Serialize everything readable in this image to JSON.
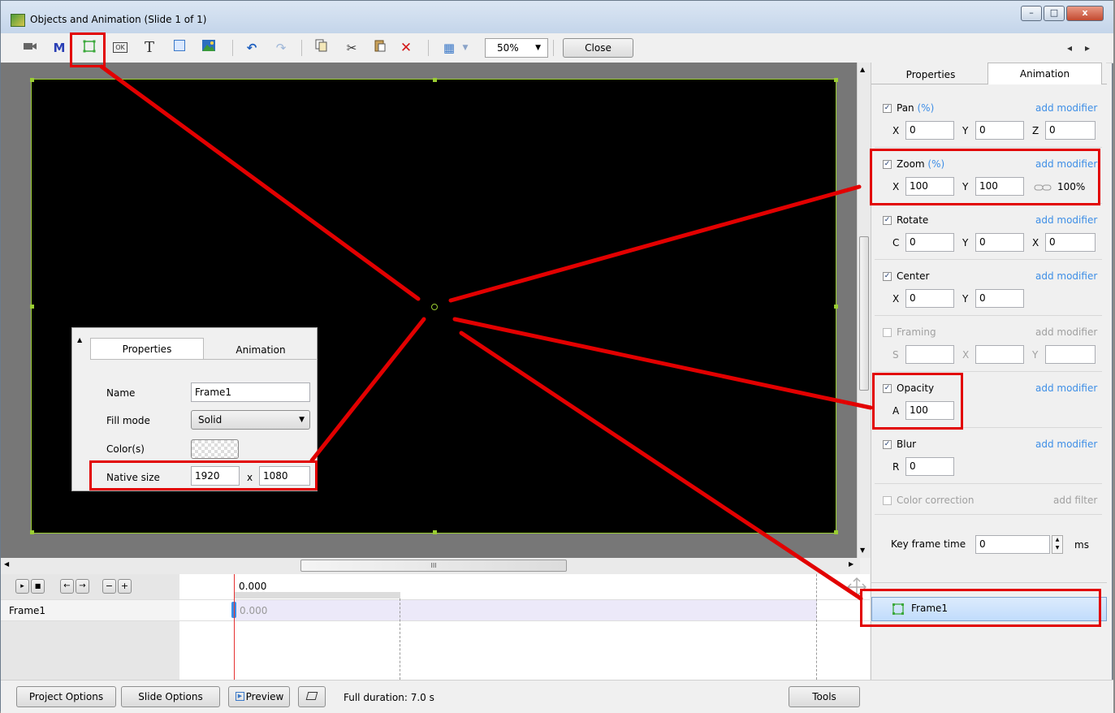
{
  "window": {
    "title": "Objects and Animation (Slide 1 of 1)",
    "minimize_glyph": "–",
    "maximize_glyph": "□",
    "close_glyph": "x"
  },
  "toolbar": {
    "icons": {
      "camera": "camera-icon",
      "mask": "M",
      "frame": "frame-icon",
      "button": "OK",
      "text": "T",
      "rectangle": "rectangle-icon",
      "image": "image-icon",
      "undo": "↶",
      "redo": "↷",
      "copy": "copy-icon",
      "cut": "✂",
      "paste": "paste-icon",
      "delete": "✕",
      "grid": "▦"
    },
    "zoom": "50%",
    "close_label": "Close",
    "nav_prev": "◂",
    "nav_next": "▸"
  },
  "properties_inset": {
    "tabs": [
      "Properties",
      "Animation"
    ],
    "name_label": "Name",
    "name_value": "Frame1",
    "fill_mode_label": "Fill mode",
    "fill_mode_value": "Solid",
    "colors_label": "Color(s)",
    "native_size_label": "Native size",
    "native_w": "1920",
    "native_x": "x",
    "native_h": "1080"
  },
  "right_panel": {
    "tabs": [
      "Properties",
      "Animation"
    ],
    "add_modifier": "add modifier",
    "add_filter": "add filter",
    "pan": {
      "label": "Pan",
      "unit": "(%)",
      "x_label": "X",
      "x": "0",
      "y_label": "Y",
      "y": "0",
      "z_label": "Z",
      "z": "0"
    },
    "zoom": {
      "label": "Zoom",
      "unit": "(%)",
      "x_label": "X",
      "x": "100",
      "y_label": "Y",
      "y": "100",
      "ratio": "100%"
    },
    "rotate": {
      "label": "Rotate",
      "c_label": "C",
      "c": "0",
      "y_label": "Y",
      "y": "0",
      "x_label": "X",
      "x": "0"
    },
    "center": {
      "label": "Center",
      "x_label": "X",
      "x": "0",
      "y_label": "Y",
      "y": "0"
    },
    "framing": {
      "label": "Framing",
      "s_label": "S",
      "x_label": "X",
      "y_label": "Y"
    },
    "opacity": {
      "label": "Opacity",
      "a_label": "A",
      "a": "100"
    },
    "blur": {
      "label": "Blur",
      "r_label": "R",
      "r": "0"
    },
    "color_correction": {
      "label": "Color correction"
    },
    "key_frame": {
      "label": "Key frame time",
      "value": "0",
      "unit": "ms"
    },
    "objects": [
      {
        "name": "Frame1"
      }
    ]
  },
  "timeline": {
    "controls": [
      "▸",
      "■",
      "←",
      "→",
      "−",
      "+"
    ],
    "time_header": "0.000",
    "row_name": "Frame1",
    "row_time": "0.000",
    "hscroll_grip": "III"
  },
  "statusbar": {
    "project_options": "Project Options",
    "slide_options": "Slide Options",
    "preview": "Preview",
    "full_duration": "Full duration: 7.0 s",
    "tools": "Tools"
  },
  "colors": {
    "highlight_red": "#e20000",
    "canvas_black": "#000000",
    "selection_green": "#9acd32",
    "link_blue": "#3e8ee6"
  }
}
